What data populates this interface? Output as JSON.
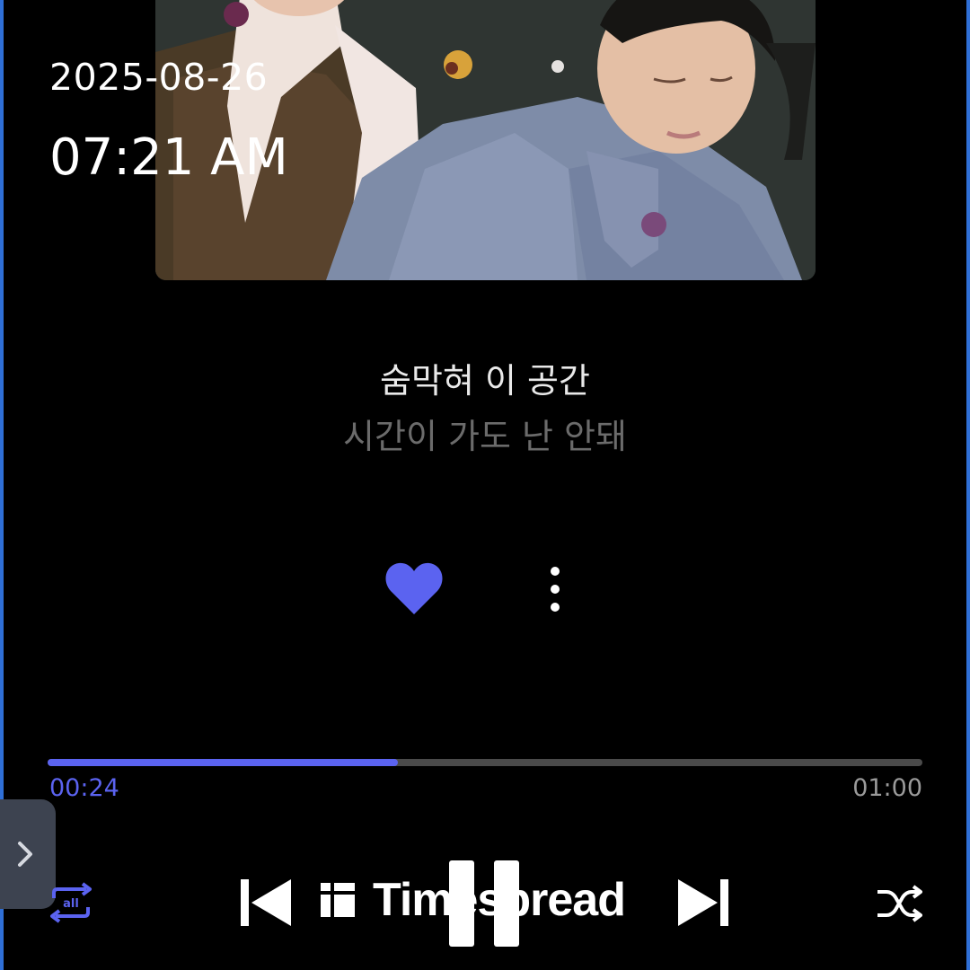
{
  "status": {
    "date": "2025-08-26",
    "time": "07:21 AM"
  },
  "album_art": {
    "icon": "album-cover-image"
  },
  "lyrics": {
    "current_line": "숨막혀 이 공간",
    "next_line": "시간이 가도 난 안돼"
  },
  "actions": {
    "like_icon": "heart-icon",
    "like_color": "#5b63f0",
    "more_icon": "more-vertical-icon"
  },
  "playback": {
    "elapsed": "00:24",
    "total": "01:00",
    "progress_fraction": 0.4,
    "accent_color": "#5b63f0",
    "repeat_label": "all"
  },
  "watermark": {
    "text": "Timespread"
  }
}
